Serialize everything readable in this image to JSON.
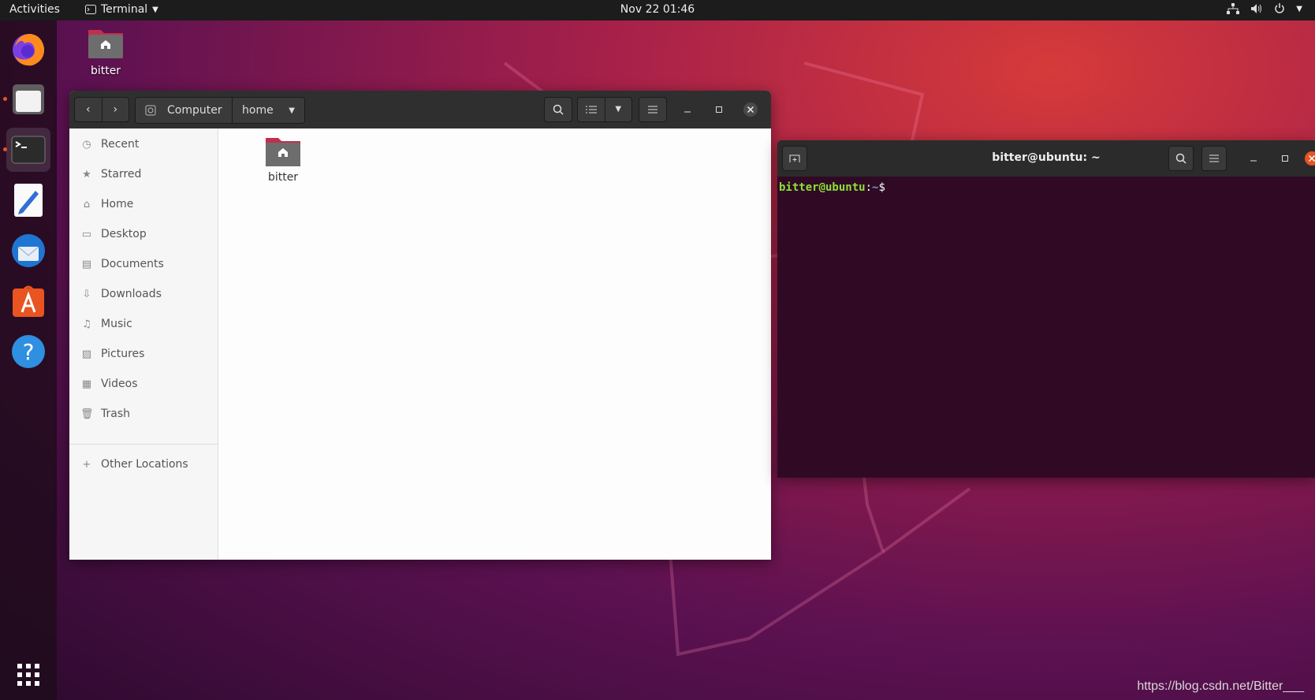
{
  "topbar": {
    "activities": "Activities",
    "app_menu": "Terminal",
    "clock": "Nov 22  01:46"
  },
  "dock": {
    "items": [
      {
        "name": "firefox"
      },
      {
        "name": "files",
        "running": true
      },
      {
        "name": "terminal",
        "running": true,
        "active": true
      },
      {
        "name": "text-editor"
      },
      {
        "name": "thunderbird"
      },
      {
        "name": "software"
      },
      {
        "name": "help"
      }
    ]
  },
  "desktop": {
    "home_icon_label": "bitter"
  },
  "files": {
    "path": [
      "Computer",
      "home"
    ],
    "sidebar": [
      {
        "label": "Recent",
        "icon": "clock-icon"
      },
      {
        "label": "Starred",
        "icon": "star-icon"
      },
      {
        "label": "Home",
        "icon": "home-icon"
      },
      {
        "label": "Desktop",
        "icon": "desktop-icon"
      },
      {
        "label": "Documents",
        "icon": "document-icon"
      },
      {
        "label": "Downloads",
        "icon": "download-icon"
      },
      {
        "label": "Music",
        "icon": "music-icon"
      },
      {
        "label": "Pictures",
        "icon": "picture-icon"
      },
      {
        "label": "Videos",
        "icon": "video-icon"
      },
      {
        "label": "Trash",
        "icon": "trash-icon"
      }
    ],
    "other_locations": "Other Locations",
    "items": [
      {
        "label": "bitter"
      }
    ]
  },
  "terminal": {
    "title": "bitter@ubuntu: ~",
    "prompt_user": "bitter@ubuntu",
    "prompt_sep": ":",
    "prompt_path": "~",
    "prompt_symbol": "$"
  },
  "watermark": "https://blog.csdn.net/Bitter___",
  "colors": {
    "accent": "#e95420",
    "terminal_bg": "#300a24",
    "prompt_user": "#8ae234",
    "prompt_path": "#729fcf"
  }
}
